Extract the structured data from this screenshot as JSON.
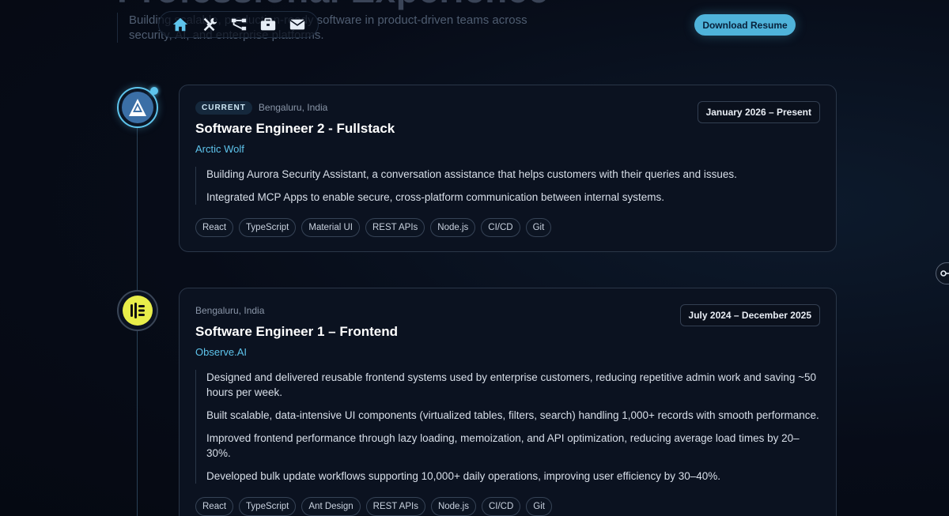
{
  "hero": {
    "title": "Professional Experience",
    "subtitle": "Building scalable, production-ready software in product-driven teams across security, AI, and enterprise platforms."
  },
  "nav": {
    "items": [
      {
        "icon": "home-icon"
      },
      {
        "icon": "tools-icon"
      },
      {
        "icon": "sitemap-icon"
      },
      {
        "icon": "briefcase-icon"
      },
      {
        "icon": "envelope-icon"
      }
    ]
  },
  "download_label": "Download Resume",
  "experience": [
    {
      "badge": "CURRENT",
      "location": "Bengaluru, India",
      "dates": "January 2026 – Present",
      "role": "Software Engineer 2 - Fullstack",
      "company": "Arctic Wolf",
      "bullets": [
        "Building Aurora Security Assistant, a conversation assistance that helps customers with their queries and issues.",
        "Integrated MCP Apps to enable secure, cross-platform communication between internal systems."
      ],
      "tags": [
        "React",
        "TypeScript",
        "Material UI",
        "REST APIs",
        "Node.js",
        "CI/CD",
        "Git"
      ]
    },
    {
      "location": "Bengaluru, India",
      "dates": "July 2024 – December 2025",
      "role": "Software Engineer 1 – Frontend",
      "company": "Observe.AI",
      "bullets": [
        "Designed and delivered reusable frontend systems used by enterprise customers, reducing repetitive admin work and saving ~50 hours per week.",
        "Built scalable, data-intensive UI components (virtualized tables, filters, search) handling 1,000+ records with smooth performance.",
        "Improved frontend performance through lazy loading, memoization, and API optimization, reducing average load times by 20–30%.",
        "Developed bulk update workflows supporting 10,000+ daily operations, improving user efficiency by 30–40%."
      ],
      "tags": [
        "React",
        "TypeScript",
        "Ant Design",
        "REST APIs",
        "Node.js",
        "CI/CD",
        "Git"
      ]
    }
  ],
  "colors": {
    "accent": "#5ec4ec",
    "button": "#4fb3da",
    "background": "#070c18",
    "card": "#0b1220"
  }
}
